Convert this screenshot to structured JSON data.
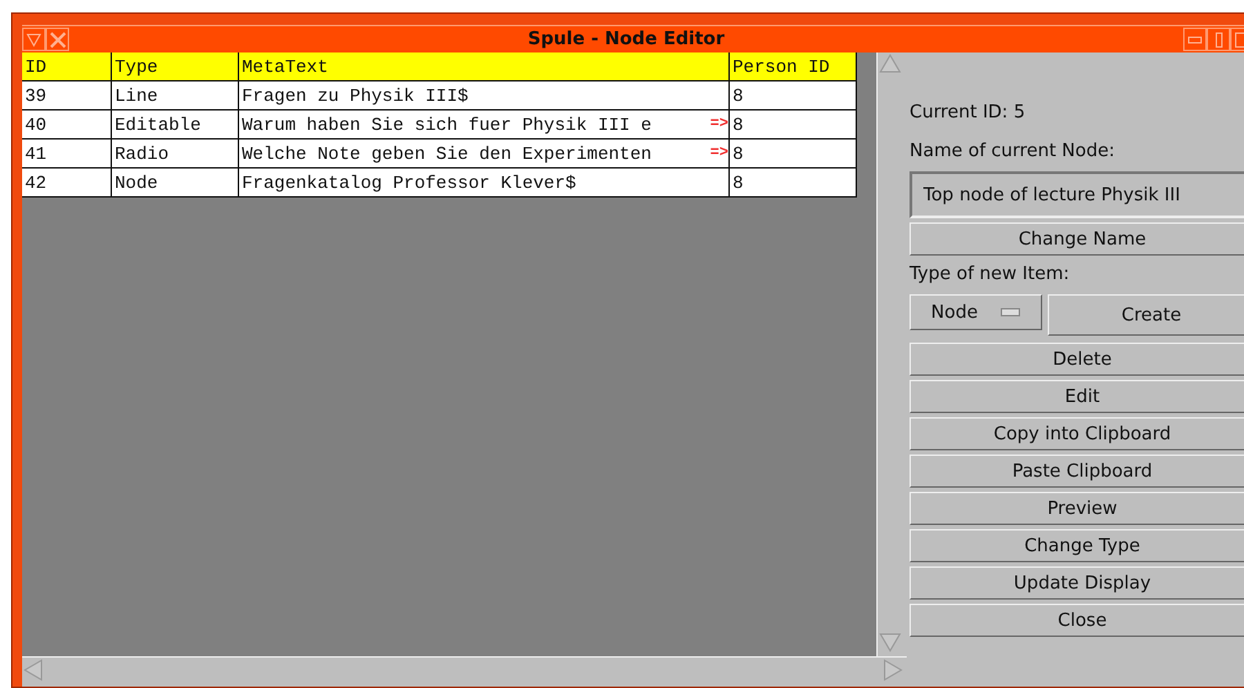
{
  "window": {
    "title": "Spule - Node Editor"
  },
  "table": {
    "columns": [
      "ID",
      "Type",
      "MetaText",
      "Person ID"
    ],
    "rows": [
      {
        "id": "39",
        "type": "Line",
        "metatext": "Fragen zu Physik III$",
        "person_id": "8"
      },
      {
        "id": "40",
        "type": "Editable",
        "metatext": "Warum haben Sie sich fuer Physik III e",
        "overflow_marker": "=>",
        "person_id": "8"
      },
      {
        "id": "41",
        "type": "Radio",
        "metatext": "Welche Note geben Sie den Experimenten",
        "overflow_marker": "=>",
        "person_id": "8"
      },
      {
        "id": "42",
        "type": "Node",
        "metatext": "Fragenkatalog Professor Klever$",
        "person_id": "8"
      }
    ]
  },
  "panel": {
    "current_id": "Current ID: 5",
    "name_label": "Name of current Node:",
    "name_value": "Top node of lecture Physik III",
    "change_name": "Change Name",
    "type_label": "Type of new Item:",
    "type_select": "Node",
    "create": "Create",
    "buttons": [
      "Delete",
      "Edit",
      "Copy into Clipboard",
      "Paste Clipboard",
      "Preview",
      "Change Type",
      "Update Display",
      "Close"
    ]
  }
}
